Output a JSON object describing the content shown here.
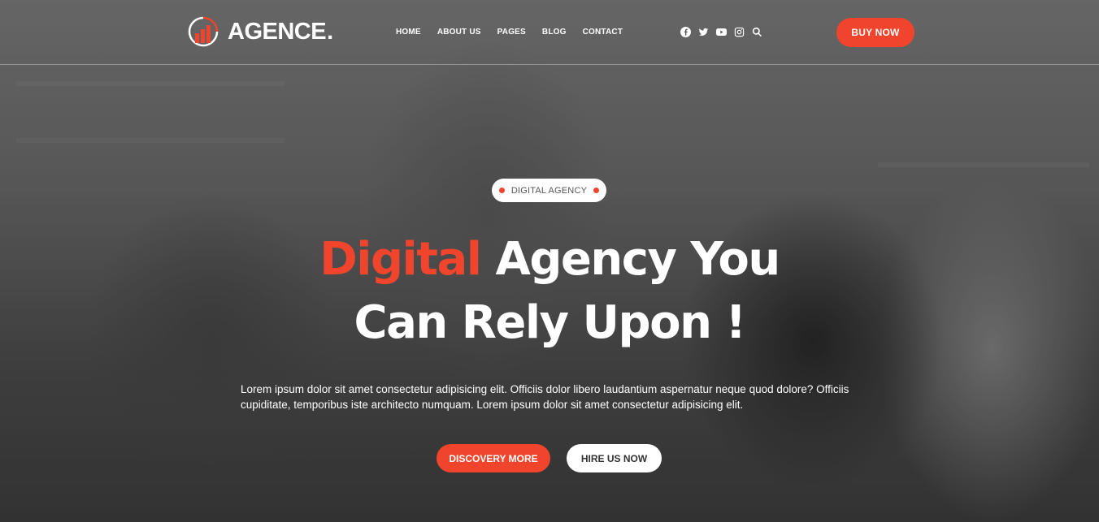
{
  "header": {
    "logo_text": "AGENCE",
    "logo_dot": ".",
    "nav": [
      "HOME",
      "ABOUT US",
      "PAGES",
      "BLOG",
      "CONTACT"
    ],
    "social_icons": [
      "facebook-icon",
      "twitter-icon",
      "youtube-icon",
      "instagram-icon",
      "search-icon"
    ],
    "buy_label": "BUY NOW"
  },
  "hero": {
    "badge": "DIGITAL AGENCY",
    "headline_accent": "Digital",
    "headline_rest_line1": " Agency You",
    "headline_line2": "Can Rely Upon !",
    "description": "Lorem ipsum dolor sit amet consectetur adipisicing elit. Officiis dolor libero laudantium aspernatur neque quod dolore? Officiis cupiditate, temporibus iste architecto numquam. Lorem ipsum dolor sit amet consectetur adipisicing elit.",
    "primary_button": "DISCOVERY MORE",
    "secondary_button": "HIRE US NOW"
  },
  "colors": {
    "accent": "#f0452c",
    "text_light": "#ffffff"
  }
}
